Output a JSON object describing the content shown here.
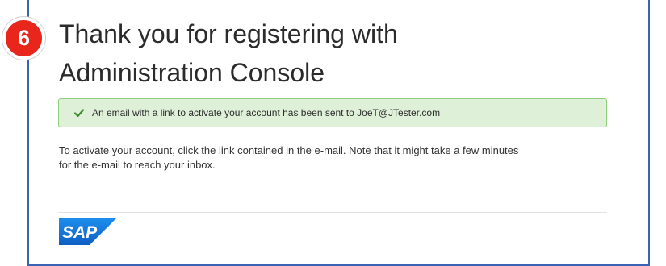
{
  "step_badge": "6",
  "heading": {
    "line1": "Thank you for registering with",
    "line2": "Administration Console"
  },
  "alert": {
    "icon": "check-icon",
    "text": "An email with a link to activate your account has been sent to JoeT@JTester.com",
    "color": "#dff0d8"
  },
  "body": {
    "line1": "To activate your account, click the link contained in the e-mail. Note that it might take a few minutes",
    "line2": "for the e-mail to reach your inbox."
  },
  "footer": {
    "logo_text": "SAP",
    "logo_color": "#1c6ed8"
  }
}
